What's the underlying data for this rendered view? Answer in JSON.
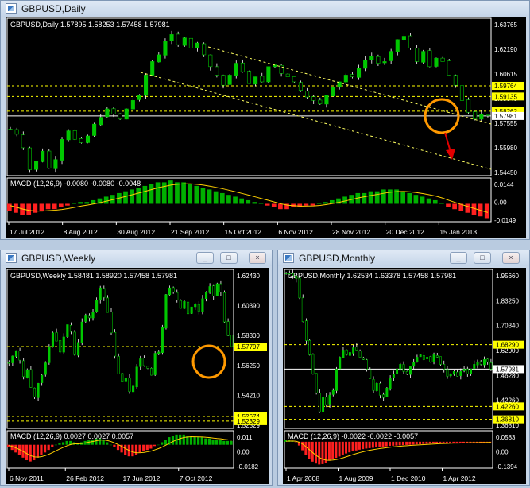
{
  "windows": [
    {
      "id": "daily",
      "title": "GBPUSD,Daily",
      "header": "GBPUSD,Daily  1.57895 1.58253 1.57458 1.57981",
      "buttons": [
        "_",
        "□",
        "×"
      ]
    },
    {
      "id": "weekly",
      "title": "GBPUSD,Weekly",
      "header": "GBPUSD,Weekly  1.58481 1.58920 1.57458 1.57981",
      "buttons": [
        "_",
        "□",
        "×"
      ]
    },
    {
      "id": "monthly",
      "title": "GBPUSD,Monthly",
      "header": "GBPUSD,Monthly  1.62534 1.63378 1.57458 1.57981",
      "buttons": [
        "_",
        "□",
        "×"
      ]
    }
  ],
  "colors": {
    "background": "#000000",
    "candle_up": "#00c800",
    "candle_wick": "#ffffff",
    "current_price_line": "#c0c0c0",
    "level_line": "#ffff00",
    "trend_line": "#ffff60",
    "macd_up": "#00b000",
    "macd_down": "#ff2020",
    "macd_signal": "#ffd000",
    "circle": "#ff9900",
    "arrow": "#e00000",
    "price_tag_bg": "#ffff00"
  },
  "chart_data": [
    {
      "type": "candlestick",
      "panel": "daily",
      "title": "GBPUSD,Daily",
      "ohlc_last": [
        1.57895,
        1.58253,
        1.57458,
        1.57981
      ],
      "ylim": [
        1.5445,
        1.6376
      ],
      "y_ticks": [
        "1.63765",
        "1.62190",
        "1.60615",
        "1.59040",
        "1.57555",
        "1.55980",
        "1.54450"
      ],
      "x_ticks": [
        "17 Jul 2012",
        "8 Aug 2012",
        "30 Aug 2012",
        "21 Sep 2012",
        "15 Oct 2012",
        "6 Nov 2012",
        "28 Nov 2012",
        "20 Dec 2012",
        "15 Jan 2013"
      ],
      "levels": [
        {
          "value": 1.59764,
          "label": "1.59764",
          "color": "#ffff00"
        },
        {
          "value": 1.59135,
          "label": "1.59135",
          "color": "#ffff00"
        },
        {
          "value": 1.58262,
          "label": "1.58262",
          "color": "#ffff00"
        },
        {
          "value": 1.57981,
          "label": "1.57981",
          "color": "#ffffff"
        }
      ],
      "close_path": [
        1.572,
        1.569,
        1.561,
        1.548,
        1.553,
        1.559,
        1.549,
        1.554,
        1.566,
        1.571,
        1.566,
        1.564,
        1.568,
        1.575,
        1.579,
        1.584,
        1.581,
        1.578,
        1.584,
        1.589,
        1.592,
        1.604,
        1.612,
        1.616,
        1.624,
        1.628,
        1.622,
        1.626,
        1.62,
        1.623,
        1.616,
        1.609,
        1.604,
        1.598,
        1.604,
        1.611,
        1.606,
        1.599,
        1.603,
        1.6,
        1.609,
        1.61,
        1.605,
        1.603,
        1.6,
        1.595,
        1.591,
        1.589,
        1.587,
        1.592,
        1.597,
        1.6,
        1.604,
        1.603,
        1.608,
        1.613,
        1.615,
        1.611,
        1.612,
        1.618,
        1.625,
        1.627,
        1.62,
        1.612,
        1.618,
        1.609,
        1.614,
        1.612,
        1.604,
        1.598,
        1.589,
        1.582,
        1.578,
        1.581,
        1.58
      ],
      "macd": {
        "label": "MACD (12,26,9) -0.0080 -0.0080 -0.0048",
        "ylim": [
          -0.01,
          0.0144
        ],
        "y_ticks": [
          "0.0144",
          "0.00",
          "-0.0149"
        ],
        "histogram": [
          -0.004,
          -0.005,
          -0.006,
          -0.006,
          -0.005,
          -0.004,
          -0.003,
          -0.003,
          -0.002,
          -0.001,
          0.0,
          0.001,
          0.001,
          0.002,
          0.003,
          0.004,
          0.005,
          0.006,
          0.007,
          0.008,
          0.009,
          0.01,
          0.011,
          0.012,
          0.012,
          0.013,
          0.012,
          0.012,
          0.011,
          0.01,
          0.009,
          0.008,
          0.007,
          0.006,
          0.005,
          0.004,
          0.003,
          0.002,
          0.001,
          0.0,
          -0.001,
          -0.002,
          -0.003,
          -0.003,
          -0.002,
          -0.002,
          -0.001,
          -0.001,
          0.0,
          0.001,
          0.002,
          0.003,
          0.004,
          0.005,
          0.006,
          0.006,
          0.007,
          0.007,
          0.008,
          0.008,
          0.008,
          0.007,
          0.006,
          0.005,
          0.004,
          0.003,
          0.002,
          0.0,
          -0.002,
          -0.003,
          -0.004,
          -0.005,
          -0.006,
          -0.007,
          -0.008
        ]
      }
    },
    {
      "type": "candlestick",
      "panel": "weekly",
      "title": "GBPUSD,Weekly",
      "ohlc_last": [
        1.58481,
        1.5892,
        1.57458,
        1.57981
      ],
      "ylim": [
        1.518,
        1.6345
      ],
      "y_ticks": [
        "1.62430",
        "1.60390",
        "1.58300",
        "1.56250",
        "1.54210",
        "1.52329"
      ],
      "x_ticks": [
        "6 Nov 2011",
        "26 Feb 2012",
        "17 Jun 2012",
        "7 Oct 2012"
      ],
      "levels": [
        {
          "value": 1.57797,
          "label": "1.57797",
          "color": "#ffff00"
        },
        {
          "value": 1.52674,
          "label": "1.52674",
          "color": "#ffff00"
        },
        {
          "value": 1.52329,
          "label": "1.52329",
          "color": "#ffff00"
        }
      ],
      "close_path": [
        1.566,
        1.571,
        1.575,
        1.568,
        1.556,
        1.561,
        1.548,
        1.541,
        1.551,
        1.557,
        1.566,
        1.578,
        1.588,
        1.582,
        1.574,
        1.585,
        1.594,
        1.589,
        1.572,
        1.581,
        1.596,
        1.601,
        1.599,
        1.603,
        1.612,
        1.621,
        1.614,
        1.603,
        1.588,
        1.571,
        1.558,
        1.552,
        1.555,
        1.545,
        1.549,
        1.563,
        1.569,
        1.564,
        1.562,
        1.557,
        1.573,
        1.574,
        1.592,
        1.616,
        1.621,
        1.618,
        1.612,
        1.606,
        1.611,
        1.602,
        1.607,
        1.609,
        1.604,
        1.613,
        1.618,
        1.622,
        1.615,
        1.624,
        1.618,
        1.596,
        1.586,
        1.578
      ],
      "macd": {
        "label": "MACD (12,26,9) 0.0027 0.0027 0.0057",
        "ylim": [
          -0.0182,
          0.011
        ],
        "y_ticks": [
          "0.011",
          "0.00",
          "-0.0182"
        ],
        "histogram": [
          -0.002,
          -0.004,
          -0.006,
          -0.008,
          -0.01,
          -0.012,
          -0.013,
          -0.012,
          -0.01,
          -0.008,
          -0.006,
          -0.004,
          -0.002,
          0.0,
          0.001,
          0.002,
          0.003,
          0.003,
          0.002,
          0.001,
          0.002,
          0.003,
          0.004,
          0.004,
          0.005,
          0.005,
          0.004,
          0.002,
          0.0,
          -0.002,
          -0.004,
          -0.006,
          -0.008,
          -0.009,
          -0.009,
          -0.008,
          -0.006,
          -0.005,
          -0.004,
          -0.003,
          -0.001,
          0.0,
          0.002,
          0.004,
          0.006,
          0.007,
          0.008,
          0.008,
          0.008,
          0.007,
          0.007,
          0.006,
          0.006,
          0.006,
          0.005,
          0.005,
          0.004,
          0.004,
          0.004,
          0.003,
          0.003,
          0.003
        ]
      }
    },
    {
      "type": "candlestick",
      "panel": "monthly",
      "title": "GBPUSD,Monthly",
      "ohlc_last": [
        1.62534,
        1.63378,
        1.57458,
        1.57981
      ],
      "ylim": [
        1.33,
        2.0
      ],
      "y_ticks": [
        "1.95660",
        "1.83250",
        "1.70340",
        "1.62000",
        "1.46280",
        "1.42260",
        "1.36810"
      ],
      "x_ticks": [
        "1 Apr 2008",
        "1 Aug 2009",
        "1 Dec 2010",
        "1 Apr 2012"
      ],
      "levels": [
        {
          "value": 1.6829,
          "label": "1.68290",
          "color": "#ffff00"
        },
        {
          "value": 1.4226,
          "label": "1.42260",
          "color": "#ffff00"
        },
        {
          "value": 1.3681,
          "label": "1.36810",
          "color": "#ffff00"
        },
        {
          "value": 1.57981,
          "label": "1.57981",
          "color": "#ffffff"
        }
      ],
      "close_path": [
        1.985,
        1.982,
        1.975,
        1.962,
        1.88,
        1.78,
        1.7,
        1.64,
        1.56,
        1.48,
        1.4,
        1.46,
        1.43,
        1.47,
        1.49,
        1.58,
        1.63,
        1.66,
        1.64,
        1.65,
        1.67,
        1.66,
        1.63,
        1.62,
        1.58,
        1.54,
        1.49,
        1.52,
        1.47,
        1.46,
        1.5,
        1.54,
        1.56,
        1.58,
        1.6,
        1.57,
        1.56,
        1.59,
        1.61,
        1.63,
        1.64,
        1.62,
        1.63,
        1.61,
        1.64,
        1.63,
        1.6,
        1.58,
        1.55,
        1.56,
        1.57,
        1.55,
        1.57,
        1.58,
        1.56,
        1.58,
        1.6,
        1.61,
        1.6,
        1.62,
        1.61,
        1.58
      ],
      "macd": {
        "label": "MACD (12,26,9) -0.0022 -0.0022 -0.0057",
        "ylim": [
          -0.1394,
          0.0583
        ],
        "y_ticks": [
          "0.0583",
          "0.00",
          "-0.1394"
        ],
        "histogram": [
          0.01,
          0.008,
          0.004,
          -0.002,
          -0.02,
          -0.045,
          -0.07,
          -0.09,
          -0.105,
          -0.115,
          -0.12,
          -0.118,
          -0.11,
          -0.1,
          -0.092,
          -0.085,
          -0.078,
          -0.07,
          -0.062,
          -0.056,
          -0.05,
          -0.046,
          -0.042,
          -0.039,
          -0.036,
          -0.034,
          -0.032,
          -0.03,
          -0.028,
          -0.026,
          -0.024,
          -0.022,
          -0.021,
          -0.02,
          -0.019,
          -0.018,
          -0.017,
          -0.016,
          -0.015,
          -0.014,
          -0.013,
          -0.012,
          -0.011,
          -0.01,
          -0.009,
          -0.008,
          -0.008,
          -0.007,
          -0.007,
          -0.006,
          -0.006,
          -0.006,
          -0.005,
          -0.005,
          -0.005,
          -0.004,
          -0.004,
          -0.004,
          -0.003,
          -0.003,
          -0.002,
          -0.002
        ]
      }
    }
  ]
}
